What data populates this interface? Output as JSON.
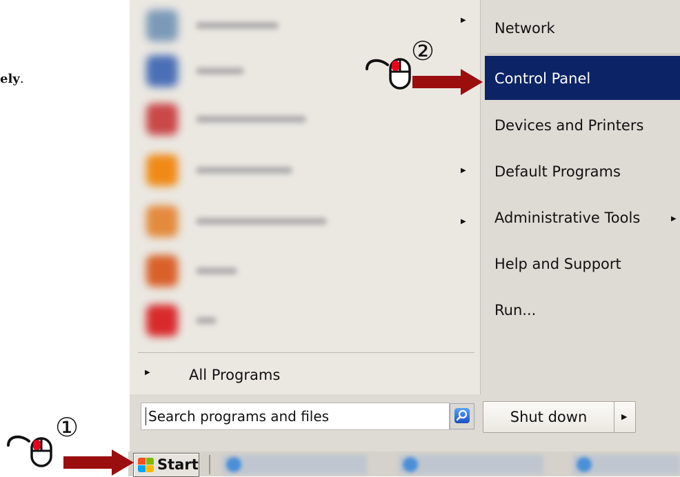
{
  "document": {
    "fragment_text": "ely",
    "fragment_punct": "."
  },
  "start_menu": {
    "left_pane": {
      "programs": [
        {
          "label": "Getting Started",
          "icon": "program-icon",
          "has_submenu": true,
          "icon_color": "#7c9ab8"
        },
        {
          "label": "Windows",
          "icon": "program-icon",
          "has_submenu": false,
          "icon_color": "#4a6fb5"
        },
        {
          "label": "Windows Live Messenger",
          "icon": "messenger-icon",
          "has_submenu": false,
          "icon_color": "#c94848"
        },
        {
          "label": "VLC media player",
          "icon": "vlc-icon",
          "has_submenu": true,
          "icon_color": "#ef8a16"
        },
        {
          "label": "Windows Media Player",
          "icon": "media-player-icon",
          "has_submenu": true,
          "icon_color": "#e38a3c"
        },
        {
          "label": "Firefox",
          "icon": "firefox-icon",
          "has_submenu": false,
          "icon_color": "#d8612a"
        },
        {
          "label": "Adobe",
          "icon": "adobe-icon",
          "has_submenu": false,
          "icon_color": "#d82a2a"
        }
      ],
      "all_programs_label": "All Programs",
      "search_placeholder": "Search programs and files"
    },
    "right_pane": {
      "items": [
        {
          "label": "Network",
          "selected": false,
          "has_submenu": false
        },
        {
          "label": "Control Panel",
          "selected": true,
          "has_submenu": false
        },
        {
          "label": "Devices and Printers",
          "selected": false,
          "has_submenu": false
        },
        {
          "label": "Default Programs",
          "selected": false,
          "has_submenu": false
        },
        {
          "label": "Administrative Tools",
          "selected": false,
          "has_submenu": true
        },
        {
          "label": "Help and Support",
          "selected": false,
          "has_submenu": false
        },
        {
          "label": "Run...",
          "selected": false,
          "has_submenu": false
        }
      ],
      "shutdown_label": "Shut down"
    }
  },
  "taskbar": {
    "start_label": "Start"
  },
  "annotations": {
    "step1_marker": "①",
    "step2_marker": "②",
    "arrow_color": "#9b0e0e",
    "mouse_button_color": "#e8001c"
  },
  "colors": {
    "selection": "#0c2466",
    "menu_background": "#ebe8e2"
  }
}
